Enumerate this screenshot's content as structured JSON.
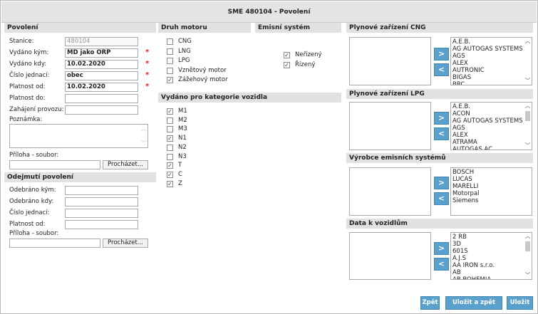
{
  "window": {
    "title": "SME 480104 - Povolení"
  },
  "povoleni": {
    "heading": "Povolení",
    "stanice_label": "Stanice:",
    "stanice_value": "480104",
    "vydano_kym_label": "Vydáno kým:",
    "vydano_kym_value": "MD jako ORP",
    "vydano_kdy_label": "Vydáno kdy:",
    "vydano_kdy_value": "10.02.2020",
    "cislo_jednaci_label": "Číslo jednací:",
    "cislo_jednaci_value": "obec",
    "platnost_od_label": "Platnost od:",
    "platnost_od_value": "10.02.2020",
    "platnost_do_label": "Platnost do:",
    "platnost_do_value": "",
    "zahajeni_label": "Zahájení provozu:",
    "zahajeni_value": "",
    "poznamka_label": "Poznámka:",
    "priloha_label": "Příloha - soubor:",
    "browse_label": "Procházet...",
    "required_mark": "*"
  },
  "odejmuti": {
    "heading": "Odejmutí povolení",
    "odebrano_kym_label": "Odebráno kým:",
    "odebrano_kdy_label": "Odebráno kdy:",
    "cislo_jednaci_label": "Číslo jednací:",
    "platnost_od_label": "Platnost od:",
    "priloha_label": "Příloha - soubor:",
    "browse_label": "Procházet..."
  },
  "druh_motoru": {
    "heading": "Druh motoru",
    "items": [
      {
        "label": "CNG",
        "checked": false
      },
      {
        "label": "LNG",
        "checked": false
      },
      {
        "label": "LPG",
        "checked": false
      },
      {
        "label": "Vznětový motor",
        "checked": false
      },
      {
        "label": "Zážehový motor",
        "checked": true
      }
    ]
  },
  "emisni_system": {
    "heading": "Emisní systém",
    "items": [
      {
        "label": "Neřízený",
        "checked": true
      },
      {
        "label": "Řízený",
        "checked": true
      }
    ]
  },
  "kategorie": {
    "heading": "Vydáno pro kategorie vozidla",
    "items": [
      {
        "label": "M1",
        "checked": true
      },
      {
        "label": "M2",
        "checked": false
      },
      {
        "label": "M3",
        "checked": false
      },
      {
        "label": "N1",
        "checked": true
      },
      {
        "label": "N2",
        "checked": false
      },
      {
        "label": "N3",
        "checked": false
      },
      {
        "label": "T",
        "checked": true
      },
      {
        "label": "C",
        "checked": true
      },
      {
        "label": "Z",
        "checked": true
      }
    ]
  },
  "cng": {
    "heading": "Plynové zařízení CNG",
    "options": [
      "A.E.B.",
      "AG AUTOGAS SYSTEMS",
      "AGS",
      "ALEX",
      "AUTRONIC",
      "BIGAS",
      "BRC"
    ]
  },
  "lpg": {
    "heading": "Plynové zařízení LPG",
    "options": [
      "A.E.B.",
      "ACON",
      "AG AUTOGAS SYSTEMS",
      "AGS",
      "ALEX",
      "ATRAMA",
      "AUTOGAS AC"
    ]
  },
  "vyrobce": {
    "heading": "Výrobce emisních systémů",
    "options": [
      "BOSCH",
      "LUCAS",
      "MARELLI",
      "Motorpal",
      "Siemens"
    ]
  },
  "data_vozidla": {
    "heading": "Data k vozidlům",
    "options": [
      "2 RB",
      "3D",
      "601S",
      "A.J.S",
      "AA IRON s.r.o.",
      "AB",
      "AB BOHEMIA"
    ]
  },
  "transfer": {
    "add": ">",
    "remove": "<"
  },
  "actions": {
    "back": "Zpět",
    "save_back": "Uložit a zpět",
    "save": "Uložit"
  }
}
